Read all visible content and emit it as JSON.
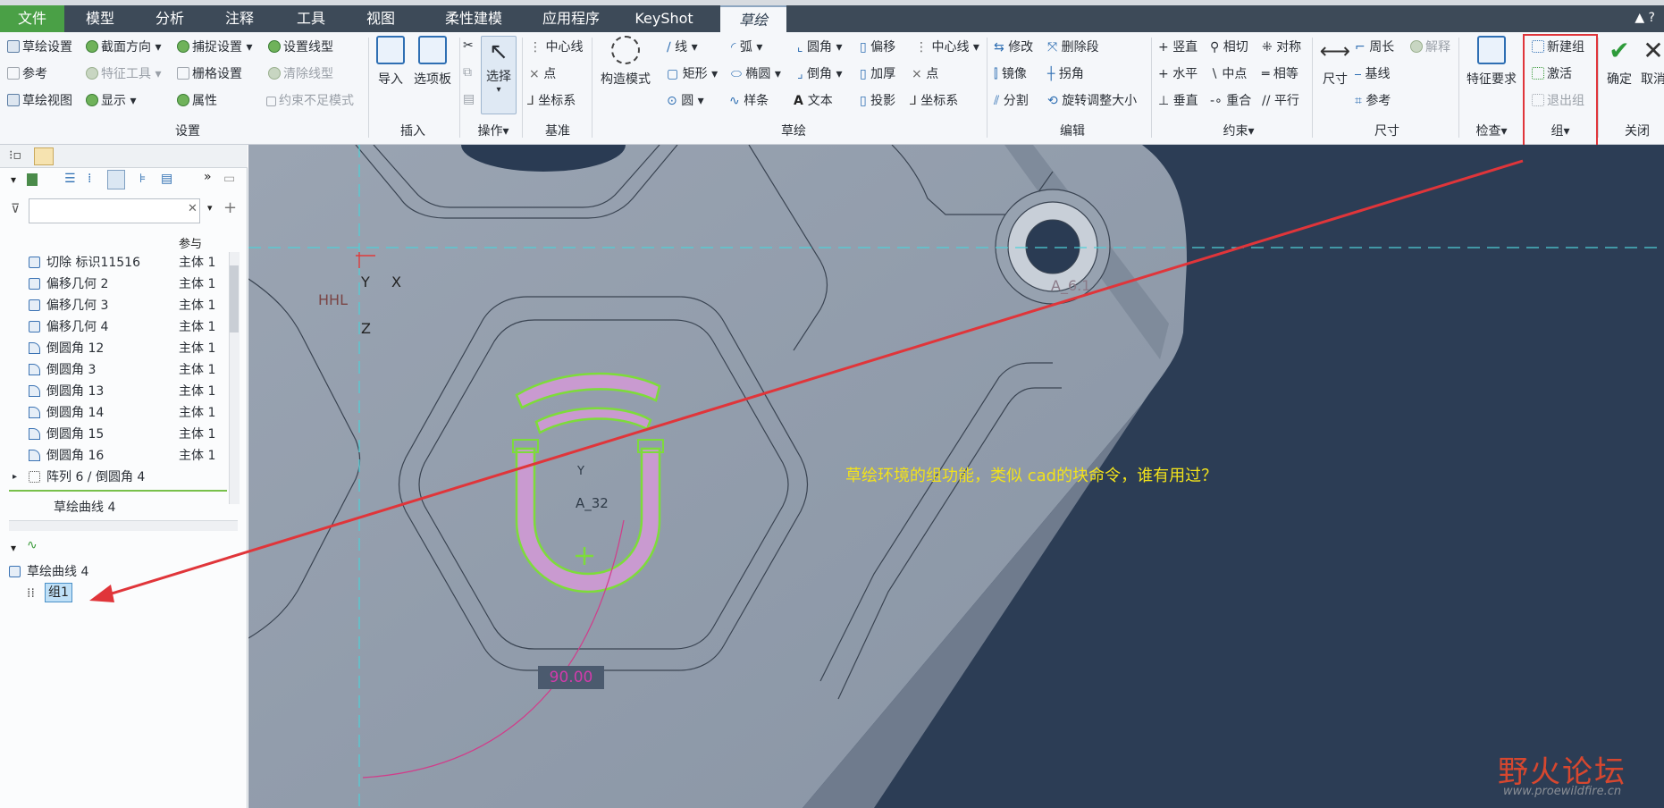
{
  "menubar": {
    "tabs": [
      {
        "label": "文件"
      },
      {
        "label": "模型"
      },
      {
        "label": "分析"
      },
      {
        "label": "注释"
      },
      {
        "label": "工具"
      },
      {
        "label": "视图"
      },
      {
        "label": "柔性建模"
      },
      {
        "label": "应用程序"
      },
      {
        "label": "KeyShot"
      },
      {
        "label": "草绘"
      }
    ],
    "right_icons": "▲ ?"
  },
  "ribbon": {
    "setup": {
      "sketch_setup": "草绘设置",
      "section_orient": "截面方向",
      "snap_settings": "捕捉设置",
      "set_linestyle": "设置线型",
      "reference": "参考",
      "feature_tools": "特征工具",
      "grid_settings": "栅格设置",
      "clear_linestyle": "清除线型",
      "sketch_view": "草绘视图",
      "display": "显示",
      "properties": "属性",
      "underconstrained": "约束不足模式",
      "group_label": "设置"
    },
    "insert": {
      "import": "导入",
      "palette": "选项板",
      "group_label": "插入"
    },
    "operations": {
      "select": "选择",
      "group_label": "操作"
    },
    "datum": {
      "centerline": "中心线",
      "point": "点",
      "coord_sys": "坐标系",
      "group_label": "基准"
    },
    "sketch": {
      "construction_mode": "构造模式",
      "line": "线",
      "arc": "弧",
      "fillet": "圆角",
      "offset": "偏移",
      "centerline": "中心线",
      "rectangle": "矩形",
      "ellipse": "椭圆",
      "chamfer": "倒角",
      "thicken": "加厚",
      "point": "点",
      "circle": "圆",
      "spline": "样条",
      "text": "文本",
      "project": "投影",
      "coord_sys": "坐标系",
      "group_label": "草绘"
    },
    "edit": {
      "modify": "修改",
      "delete_segment": "删除段",
      "mirror": "镜像",
      "corner": "拐角",
      "divide": "分割",
      "rotate_resize": "旋转调整大小",
      "group_label": "编辑"
    },
    "constrain": {
      "vertical": "竖直",
      "tangent": "相切",
      "symmetric": "对称",
      "horizontal": "水平",
      "midpoint": "中点",
      "equal": "相等",
      "perpendicular": "垂直",
      "coincident": "重合",
      "parallel": "平行",
      "group_label": "约束"
    },
    "dimension": {
      "dimension": "尺寸",
      "perimeter": "周长",
      "explain": "解释",
      "baseline": "基线",
      "reference": "参考",
      "group_label": "尺寸"
    },
    "inspect": {
      "feature_req": "特征要求",
      "group_label": "检查"
    },
    "group": {
      "new_group": "新建组",
      "activate": "激活",
      "exit_group": "退出组",
      "group_label": "组"
    },
    "close": {
      "ok": "确定",
      "cancel": "取消",
      "group_label": "关闭"
    }
  },
  "left_panel": {
    "column_header": "参与",
    "tree_items": [
      {
        "name": "切除 标识11516",
        "col": "主体 1"
      },
      {
        "name": "偏移几何 2",
        "col": "主体 1"
      },
      {
        "name": "偏移几何 3",
        "col": "主体 1"
      },
      {
        "name": "偏移几何 4",
        "col": "主体 1"
      },
      {
        "name": "倒圆角 12",
        "col": "主体 1"
      },
      {
        "name": "倒圆角 3",
        "col": "主体 1"
      },
      {
        "name": "倒圆角 13",
        "col": "主体 1"
      },
      {
        "name": "倒圆角 14",
        "col": "主体 1"
      },
      {
        "name": "倒圆角 15",
        "col": "主体 1"
      },
      {
        "name": "倒圆角 16",
        "col": "主体 1"
      },
      {
        "name": "阵列 6 / 倒圆角 4",
        "col": ""
      }
    ],
    "current_item": "草绘曲线 4",
    "sketch_section_title": "草绘曲线 4",
    "group_item": "组1"
  },
  "canvas": {
    "axis_y": "Y",
    "axis_x": "X",
    "axis_z": "Z",
    "csys_label": "HHL",
    "dim_a61": "A_6.1",
    "dim_a32": "A_32",
    "small_y": "Y",
    "dim_90": "90.00",
    "annotation": "草绘环境的组功能，类似 cad的块命令，谁有用过？",
    "colors": {
      "sketch_green": "#7ddc3a",
      "fill_pink": "#c99ad0",
      "arrow_red": "#e0353a",
      "bg_navy": "#2c3d55"
    }
  },
  "watermark": {
    "text": "野火论坛",
    "url": "www.proewildfire.cn"
  }
}
